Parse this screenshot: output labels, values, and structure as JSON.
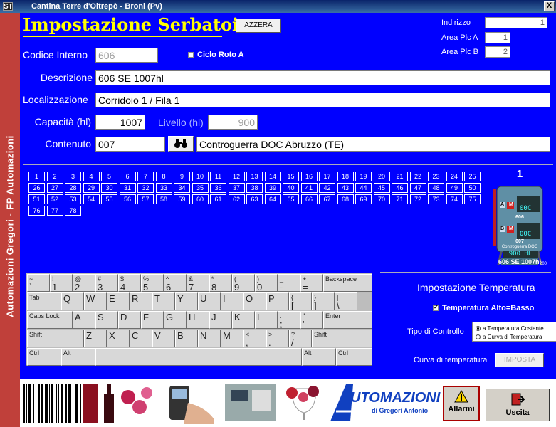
{
  "window": {
    "title": "Cantina Terre d'Oltrepò - Broni (Pv)",
    "close": "X",
    "icon": "ST"
  },
  "sidebar": {
    "text": "Automazioni Gregori - FP Automazioni"
  },
  "header": {
    "title": "Impostazione Serbatoi",
    "reset_label": "AZZERA"
  },
  "plc": {
    "indirizzo_label": "Indirizzo",
    "indirizzo": "1",
    "area_a_label": "Area Plc A",
    "area_a": "1",
    "area_b_label": "Area Plc B",
    "area_b": "2"
  },
  "form": {
    "codice_label": "Codice Interno",
    "codice": "606",
    "ciclo_label": "Ciclo Roto A",
    "descrizione_label": "Descrizione",
    "descrizione": "606 SE 1007hl",
    "localizzazione_label": "Localizzazione",
    "localizzazione": "Corridoio 1 / Fila 1",
    "capacita_label": "Capacità (hl)",
    "capacita": "1007",
    "livello_label": "Livello (hl)",
    "livello": "900",
    "contenuto_label": "Contenuto",
    "contenuto_code": "007",
    "contenuto_desc": "Controguerra DOC Abruzzo (TE)"
  },
  "tank_numbers": [
    "1",
    "2",
    "3",
    "4",
    "5",
    "6",
    "7",
    "8",
    "9",
    "10",
    "11",
    "12",
    "13",
    "14",
    "15",
    "16",
    "17",
    "18",
    "19",
    "20",
    "21",
    "22",
    "23",
    "24",
    "25",
    "26",
    "27",
    "28",
    "29",
    "30",
    "31",
    "32",
    "33",
    "34",
    "35",
    "36",
    "37",
    "38",
    "39",
    "40",
    "41",
    "42",
    "43",
    "44",
    "45",
    "46",
    "47",
    "48",
    "49",
    "50",
    "51",
    "52",
    "53",
    "54",
    "55",
    "56",
    "57",
    "58",
    "59",
    "60",
    "61",
    "62",
    "63",
    "64",
    "65",
    "66",
    "67",
    "68",
    "69",
    "70",
    "71",
    "72",
    "73",
    "74",
    "75",
    "76",
    "77",
    "78"
  ],
  "tank": {
    "number": "1",
    "a_label": "A",
    "b_label": "B",
    "m_label": "M",
    "temp_a": "00C",
    "temp_b": "00C",
    "code": "606",
    "content_code": "007",
    "content_name": "Controguerra DOC",
    "volume": "900 HL",
    "scale": "200",
    "name": "606 SE 1007hl"
  },
  "keyboard": {
    "row1": [
      [
        "~",
        "`"
      ],
      [
        "!",
        "1"
      ],
      [
        "@",
        "2"
      ],
      [
        "#",
        "3"
      ],
      [
        "$",
        "4"
      ],
      [
        "%",
        "5"
      ],
      [
        "^",
        "6"
      ],
      [
        "&",
        "7"
      ],
      [
        "*",
        "8"
      ],
      [
        "(",
        "9"
      ],
      [
        ")",
        "0"
      ],
      [
        "_",
        "-"
      ],
      [
        "+",
        "="
      ]
    ],
    "backspace": "Backspace",
    "tab": "Tab",
    "row2": [
      [
        "",
        "Q"
      ],
      [
        "",
        "W"
      ],
      [
        "",
        "E"
      ],
      [
        "",
        "R"
      ],
      [
        "",
        "T"
      ],
      [
        "",
        "Y"
      ],
      [
        "",
        "U"
      ],
      [
        "",
        "I"
      ],
      [
        "",
        "O"
      ],
      [
        "",
        "P"
      ],
      [
        "{",
        "["
      ],
      [
        "}",
        "]"
      ],
      [
        "|",
        "\\"
      ]
    ],
    "caps": "Caps Lock",
    "row3": [
      [
        "",
        "A"
      ],
      [
        "",
        "S"
      ],
      [
        "",
        "D"
      ],
      [
        "",
        "F"
      ],
      [
        "",
        "G"
      ],
      [
        "",
        "H"
      ],
      [
        "",
        "J"
      ],
      [
        "",
        "K"
      ],
      [
        "",
        "L"
      ],
      [
        ":",
        ";"
      ],
      [
        "\"",
        "'"
      ]
    ],
    "enter": "Enter",
    "shift": "Shift",
    "row4": [
      [
        "",
        "Z"
      ],
      [
        "",
        "X"
      ],
      [
        "",
        "C"
      ],
      [
        "",
        "V"
      ],
      [
        "",
        "B"
      ],
      [
        "",
        "N"
      ],
      [
        "",
        "M"
      ],
      [
        "<",
        ","
      ],
      [
        ">",
        "."
      ],
      [
        "?",
        "/"
      ]
    ],
    "ctrl": "Ctrl",
    "alt": "Alt"
  },
  "temperature": {
    "title": "Impostazione Temperatura",
    "alto_basso_label": "Temperatura Alto=Basso",
    "tipo_label": "Tipo di Controllo",
    "opt1": "a Temperatura Costante",
    "opt2": "a Curva di Temperatura",
    "curva_label": "Curva di temperatura",
    "imposta_label": "IMPOSTA"
  },
  "footer": {
    "logo_main": "UTOMAZIONI",
    "logo_sub": "di Gregori Antonio",
    "allarmi_label": "Allarmi",
    "uscita_label": "Uscita"
  },
  "colors": {
    "bg": "#0000ff",
    "title": "#ffff00",
    "sidebar": "#c0403a"
  }
}
